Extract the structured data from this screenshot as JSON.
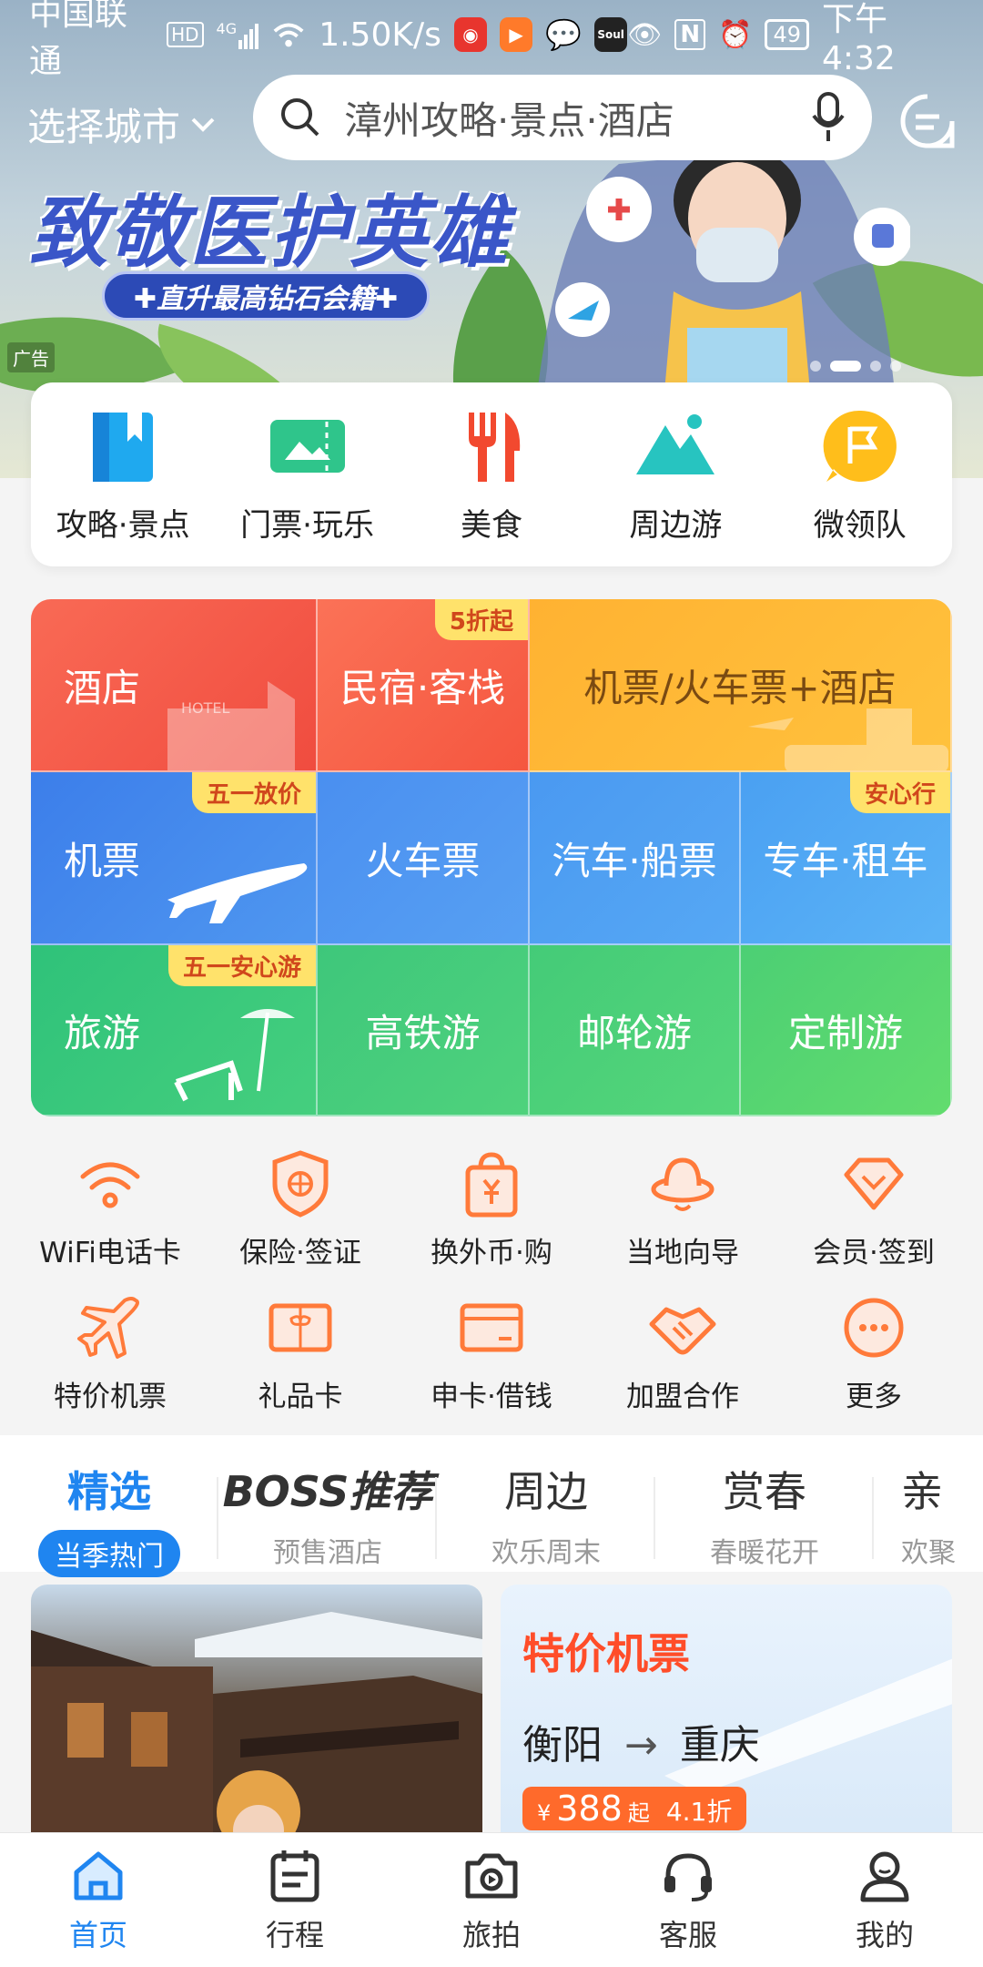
{
  "status_bar": {
    "carrier": "中国联通",
    "hd": "HD",
    "network": "4G",
    "speed": "1.50K/s",
    "battery": "49",
    "time": "下午4:32",
    "nfc": "N",
    "soul": "Soul"
  },
  "header": {
    "city_label": "选择城市",
    "search_placeholder": "漳州攻略·景点·酒店"
  },
  "banner": {
    "title": "致敬医护英雄",
    "subtitle": "✚直升最高钻石会籍✚",
    "ad_label": "广告"
  },
  "quick_nav": [
    {
      "label": "攻略·景点",
      "icon": "book-icon"
    },
    {
      "label": "门票·玩乐",
      "icon": "ticket-icon"
    },
    {
      "label": "美食",
      "icon": "fork-knife-icon"
    },
    {
      "label": "周边游",
      "icon": "mountain-icon"
    },
    {
      "label": "微领队",
      "icon": "flag-icon"
    }
  ],
  "grid": {
    "hotel": "酒店",
    "hotel_sign": "HOTEL",
    "homestay": "民宿·客栈",
    "homestay_tag": "5折起",
    "flight_hotel": "机票/火车票+酒店",
    "flight": "机票",
    "flight_tag": "五一放价",
    "train": "火车票",
    "bus_ship": "汽车·船票",
    "car": "专车·租车",
    "car_tag": "安心行",
    "travel": "旅游",
    "travel_tag": "五一安心游",
    "hsr": "高铁游",
    "cruise": "邮轮游",
    "custom": "定制游"
  },
  "services": [
    {
      "label": "WiFi电话卡",
      "icon": "wifi-icon"
    },
    {
      "label": "保险·签证",
      "icon": "shield-icon"
    },
    {
      "label": "换外币·购",
      "icon": "currency-bag-icon"
    },
    {
      "label": "当地向导",
      "icon": "guide-hat-icon"
    },
    {
      "label": "会员·签到",
      "icon": "diamond-icon"
    },
    {
      "label": "特价机票",
      "icon": "plane-icon"
    },
    {
      "label": "礼品卡",
      "icon": "gift-card-icon"
    },
    {
      "label": "申卡·借钱",
      "icon": "credit-card-icon"
    },
    {
      "label": "加盟合作",
      "icon": "handshake-icon"
    },
    {
      "label": "更多",
      "icon": "more-icon"
    }
  ],
  "feed_tabs": [
    {
      "title": "精选",
      "sub": "当季热门"
    },
    {
      "title": "BOSS推荐",
      "sub": "预售酒店"
    },
    {
      "title": "周边",
      "sub": "欢乐周末"
    },
    {
      "title": "赏春",
      "sub": "春暖花开"
    },
    {
      "title": "亲",
      "sub": "欢聚"
    }
  ],
  "promo_card": {
    "title": "特价机票",
    "from": "衡阳",
    "arrow": "→",
    "to": "重庆",
    "currency": "¥",
    "price": "388",
    "price_suffix": "起",
    "discount": "4.1折"
  },
  "bottom_nav": [
    {
      "label": "首页",
      "icon": "home-icon"
    },
    {
      "label": "行程",
      "icon": "itinerary-icon"
    },
    {
      "label": "旅拍",
      "icon": "camera-icon"
    },
    {
      "label": "客服",
      "icon": "headset-icon"
    },
    {
      "label": "我的",
      "icon": "profile-icon"
    }
  ],
  "colors": {
    "brand_blue": "#1f85f0",
    "accent_orange": "#ff6a2b",
    "hotel_red": "#f5614f",
    "flight_blue": "#3e8bea",
    "travel_green": "#34c97a",
    "banner_title": "#3a56c8"
  }
}
